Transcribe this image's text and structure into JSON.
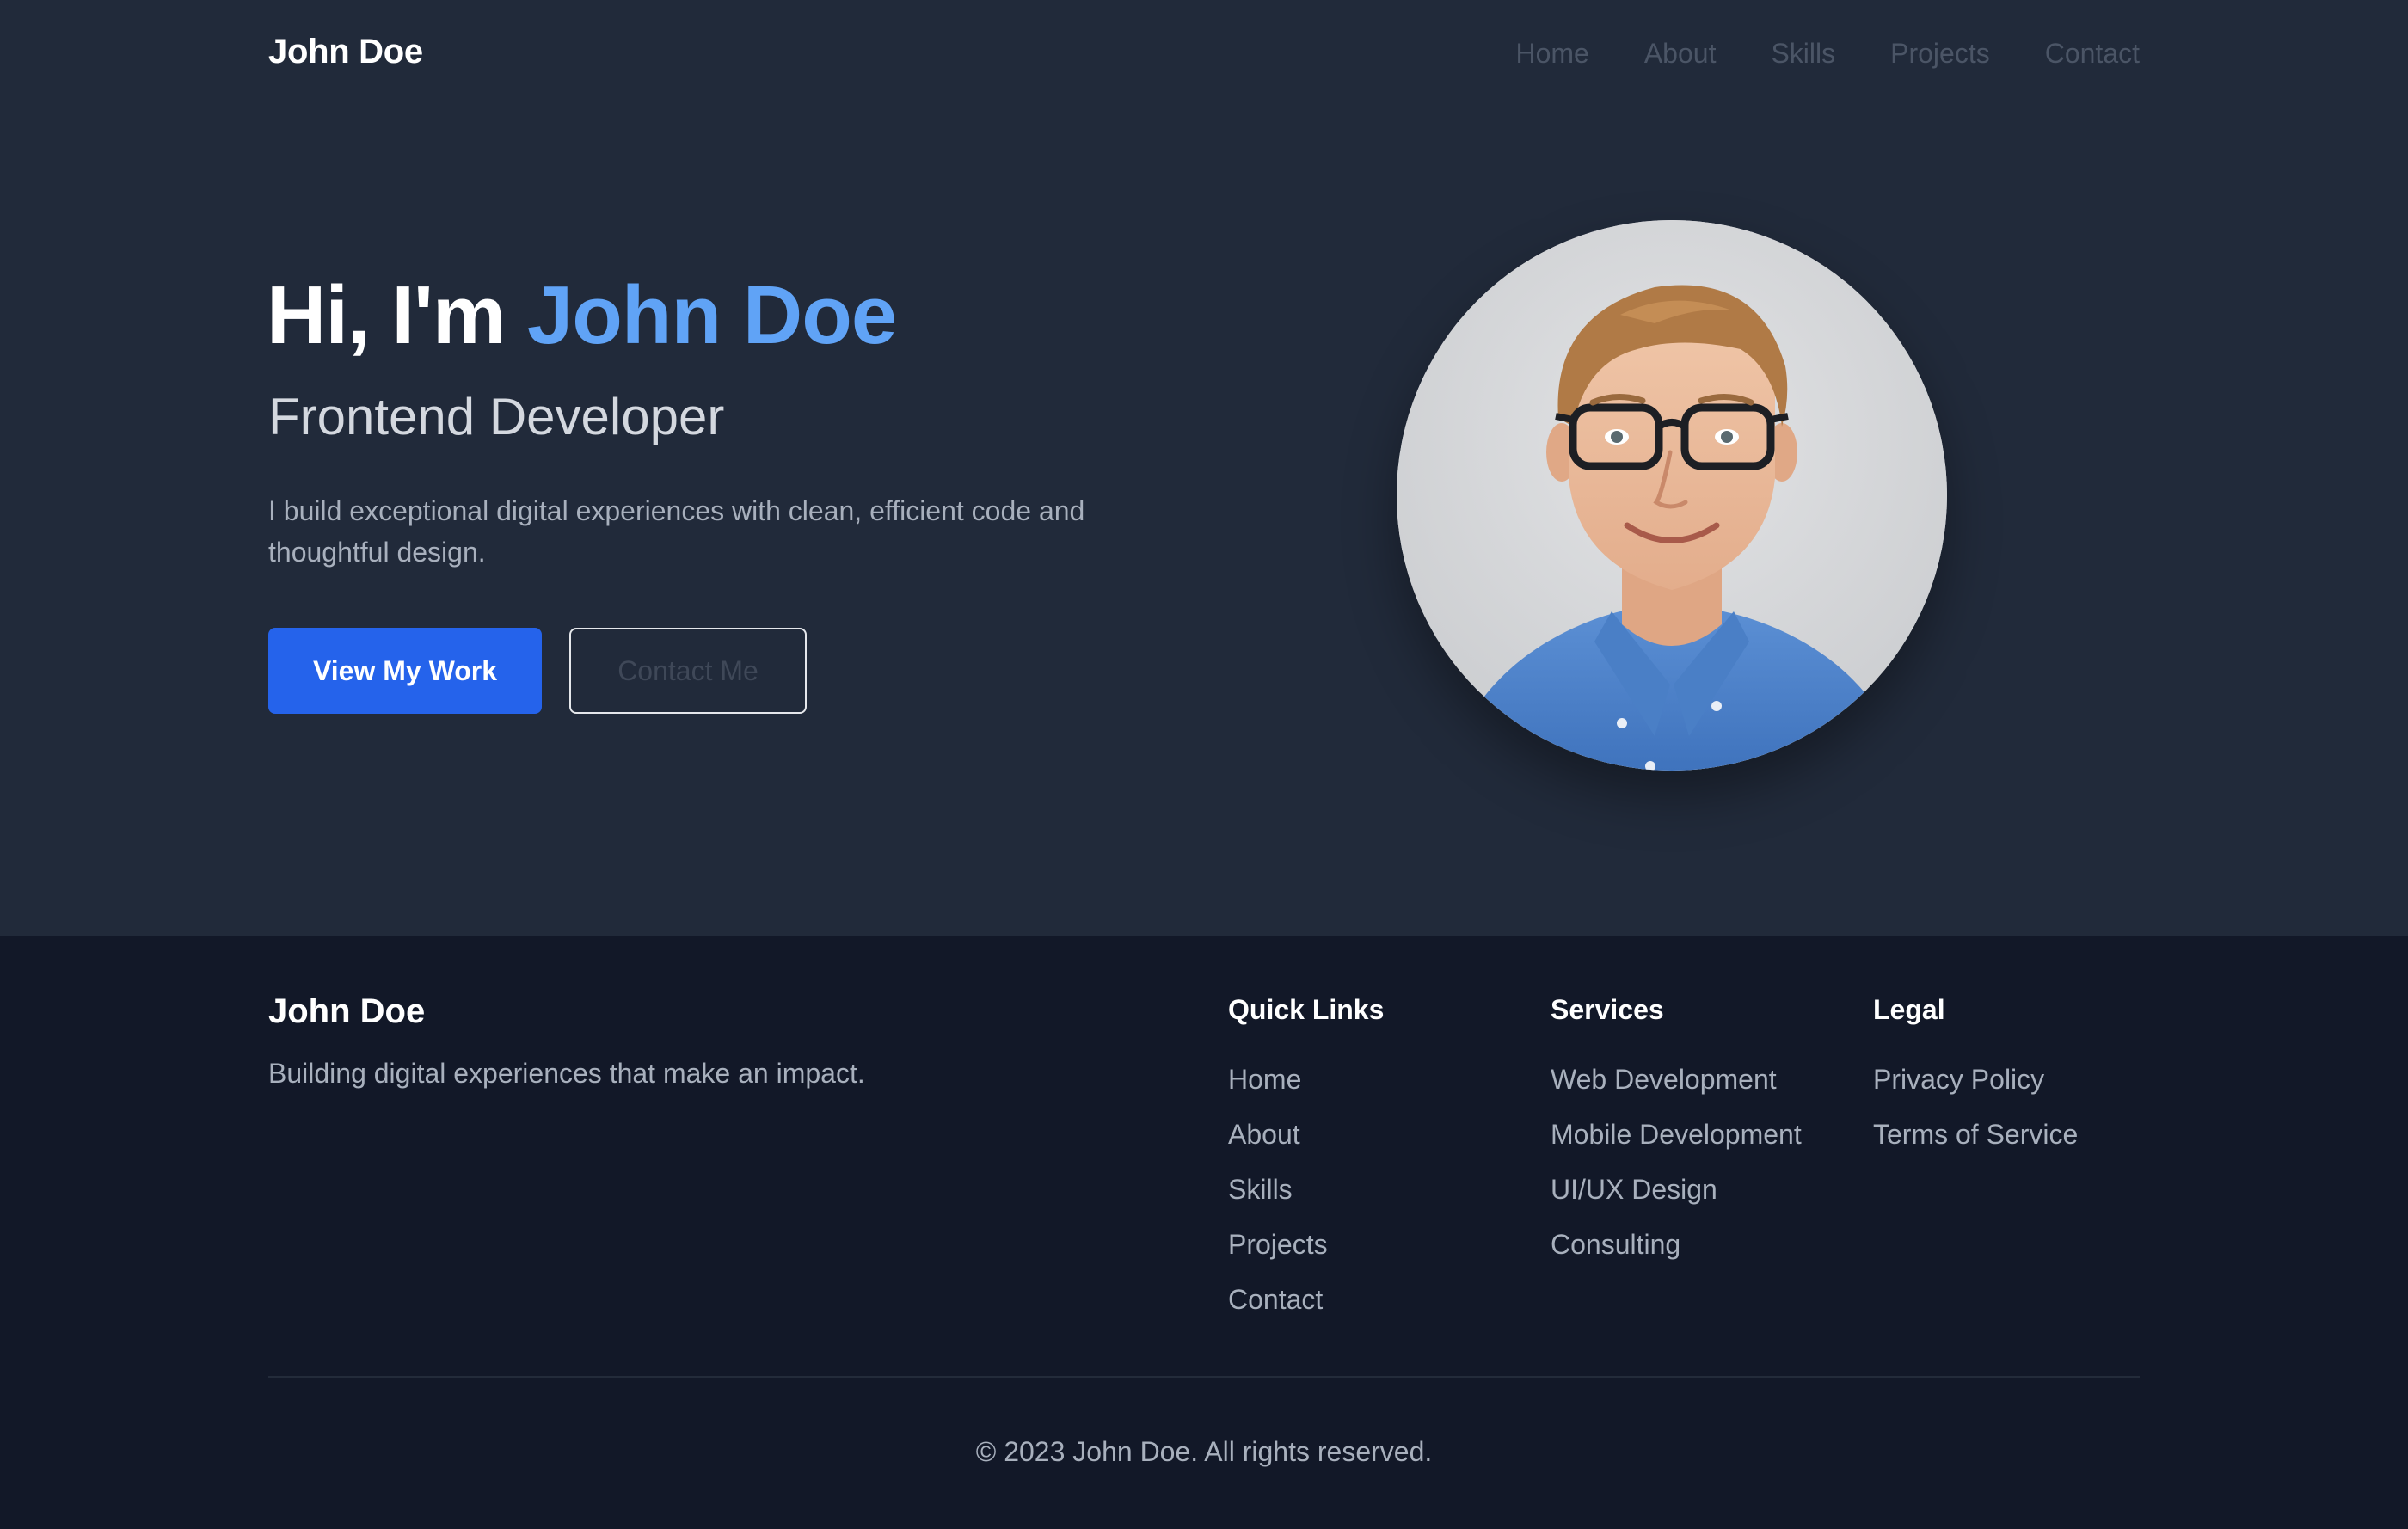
{
  "nav": {
    "brand": "John Doe",
    "links": [
      "Home",
      "About",
      "Skills",
      "Projects",
      "Contact"
    ]
  },
  "hero": {
    "greeting": "Hi, I'm",
    "name": "John Doe",
    "role": "Frontend Developer",
    "description": "I build exceptional digital experiences with clean, efficient code and thoughtful design.",
    "primary_button": "View My Work",
    "secondary_button": "Contact Me",
    "avatar_icon": "profile-photo"
  },
  "footer": {
    "brand": "John Doe",
    "tagline": "Building digital experiences that make an impact.",
    "quick_links": {
      "title": "Quick Links",
      "items": [
        "Home",
        "About",
        "Skills",
        "Projects",
        "Contact"
      ]
    },
    "services": {
      "title": "Services",
      "items": [
        "Web Development",
        "Mobile Development",
        "UI/UX Design",
        "Consulting"
      ]
    },
    "legal": {
      "title": "Legal",
      "items": [
        "Privacy Policy",
        "Terms of Service"
      ]
    },
    "copyright": "© 2023 John Doe. All rights reserved."
  },
  "colors": {
    "background": "#212a3a",
    "footer_background": "#121828",
    "accent": "#60a3f6",
    "primary_button": "#2563eb"
  }
}
